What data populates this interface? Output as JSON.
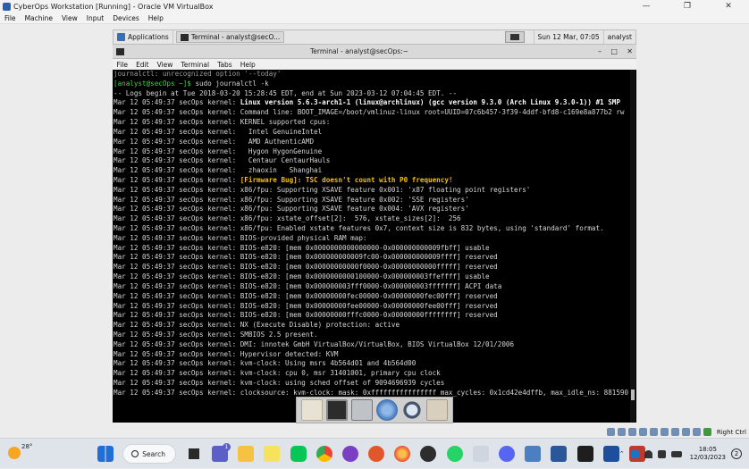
{
  "host_window": {
    "title": "CyberOps Workstation [Running] - Oracle VM VirtualBox",
    "controls": [
      "—",
      "❐",
      "✕"
    ],
    "menu": [
      "File",
      "Machine",
      "View",
      "Input",
      "Devices",
      "Help"
    ]
  },
  "guest_panel": {
    "applications_label": "Applications",
    "task_label": "Terminal - analyst@secO...",
    "clock": "Sun 12 Mar, 07:05",
    "user": "analyst"
  },
  "terminal": {
    "title": "Terminal - analyst@secOps:~",
    "controls": [
      "–",
      "□",
      "✕"
    ],
    "menu": [
      "File",
      "Edit",
      "View",
      "Terminal",
      "Tabs",
      "Help"
    ],
    "lines": [
      {
        "t": "journalctl: unrecognized option '--today'",
        "c": "dim"
      },
      {
        "p": "[analyst@secOps ~]$",
        "t": " sudo journalctl -k"
      },
      {
        "t": "-- Logs begin at Tue 2018-03-20 15:28:45 EDT, end at Sun 2023-03-12 07:04:45 EDT. --"
      },
      {
        "h": "Mar 12 05:49:37 secOps kernel: ",
        "t": "Linux version 5.6.3-arch1-1 (linux@archlinux) (gcc version 9.3.0 (Arch Linux 9.3.0-1)) #1 SMP",
        "c": "b"
      },
      {
        "h": "Mar 12 05:49:37 secOps kernel: ",
        "t": "Command line: BOOT_IMAGE=/boot/vmlinuz-linux root=UUID=07c6b457-3f39-4ddf-bfd8-c169e8a877b2 rw"
      },
      {
        "h": "Mar 12 05:49:37 secOps kernel: ",
        "t": "KERNEL supported cpus:"
      },
      {
        "h": "Mar 12 05:49:37 secOps kernel: ",
        "t": "  Intel GenuineIntel"
      },
      {
        "h": "Mar 12 05:49:37 secOps kernel: ",
        "t": "  AMD AuthenticAMD"
      },
      {
        "h": "Mar 12 05:49:37 secOps kernel: ",
        "t": "  Hygon HygonGenuine"
      },
      {
        "h": "Mar 12 05:49:37 secOps kernel: ",
        "t": "  Centaur CentaurHauls"
      },
      {
        "h": "Mar 12 05:49:37 secOps kernel: ",
        "t": "  zhaoxin   Shanghai"
      },
      {
        "h": "Mar 12 05:49:37 secOps kernel: ",
        "t": "[Firmware Bug]: TSC doesn't count with P0 frequency!",
        "c": "y"
      },
      {
        "h": "Mar 12 05:49:37 secOps kernel: ",
        "t": "x86/fpu: Supporting XSAVE feature 0x001: 'x87 floating point registers'"
      },
      {
        "h": "Mar 12 05:49:37 secOps kernel: ",
        "t": "x86/fpu: Supporting XSAVE feature 0x002: 'SSE registers'"
      },
      {
        "h": "Mar 12 05:49:37 secOps kernel: ",
        "t": "x86/fpu: Supporting XSAVE feature 0x004: 'AVX registers'"
      },
      {
        "h": "Mar 12 05:49:37 secOps kernel: ",
        "t": "x86/fpu: xstate_offset[2]:  576, xstate_sizes[2]:  256"
      },
      {
        "h": "Mar 12 05:49:37 secOps kernel: ",
        "t": "x86/fpu: Enabled xstate features 0x7, context size is 832 bytes, using 'standard' format."
      },
      {
        "h": "Mar 12 05:49:37 secOps kernel: ",
        "t": "BIOS-provided physical RAM map:"
      },
      {
        "h": "Mar 12 05:49:37 secOps kernel: ",
        "t": "BIOS-e820: [mem 0x0000000000000000-0x000000000009fbff] usable"
      },
      {
        "h": "Mar 12 05:49:37 secOps kernel: ",
        "t": "BIOS-e820: [mem 0x000000000009fc00-0x000000000009ffff] reserved"
      },
      {
        "h": "Mar 12 05:49:37 secOps kernel: ",
        "t": "BIOS-e820: [mem 0x00000000000f0000-0x00000000000fffff] reserved"
      },
      {
        "h": "Mar 12 05:49:37 secOps kernel: ",
        "t": "BIOS-e820: [mem 0x0000000000100000-0x000000003ffeffff] usable"
      },
      {
        "h": "Mar 12 05:49:37 secOps kernel: ",
        "t": "BIOS-e820: [mem 0x000000003fff0000-0x000000003fffffff] ACPI data"
      },
      {
        "h": "Mar 12 05:49:37 secOps kernel: ",
        "t": "BIOS-e820: [mem 0x00000000fec00000-0x00000000fec00fff] reserved"
      },
      {
        "h": "Mar 12 05:49:37 secOps kernel: ",
        "t": "BIOS-e820: [mem 0x00000000fee00000-0x00000000fee00fff] reserved"
      },
      {
        "h": "Mar 12 05:49:37 secOps kernel: ",
        "t": "BIOS-e820: [mem 0x00000000fffc0000-0x00000000ffffffff] reserved"
      },
      {
        "h": "Mar 12 05:49:37 secOps kernel: ",
        "t": "NX (Execute Disable) protection: active"
      },
      {
        "h": "Mar 12 05:49:37 secOps kernel: ",
        "t": "SMBIOS 2.5 present."
      },
      {
        "h": "Mar 12 05:49:37 secOps kernel: ",
        "t": "DMI: innotek GmbH VirtualBox/VirtualBox, BIOS VirtualBox 12/01/2006"
      },
      {
        "h": "Mar 12 05:49:37 secOps kernel: ",
        "t": "Hypervisor detected: KVM"
      },
      {
        "h": "Mar 12 05:49:37 secOps kernel: ",
        "t": "kvm-clock: Using msrs 4b564d01 and 4b564d00"
      },
      {
        "h": "Mar 12 05:49:37 secOps kernel: ",
        "t": "kvm-clock: cpu 0, msr 31401001, primary cpu clock"
      },
      {
        "h": "Mar 12 05:49:37 secOps kernel: ",
        "t": "kvm-clock: using sched offset of 9094696939 cycles"
      },
      {
        "h": "Mar 12 05:49:37 secOps kernel: ",
        "t": "clocksource: kvm-clock: mask: 0xffffffffffffffff max_cycles: 0x1cd42e4dffb, max_idle_ns: 881590"
      }
    ]
  },
  "guest_dock": {
    "icons": [
      "home-folder-icon",
      "terminal-icon",
      "file-manager-icon",
      "web-browser-icon",
      "app-finder-icon",
      "folder-icon"
    ]
  },
  "vbox_status": {
    "icons": [
      "hard-disk-icon",
      "optical-drive-icon",
      "audio-icon",
      "network-icon",
      "usb-icon",
      "shared-folder-icon",
      "display-icon",
      "recording-icon",
      "cpu-icon",
      "mouse-icon"
    ],
    "host_key": "Right Ctrl"
  },
  "taskbar": {
    "weather_temp": "28°",
    "search_label": "Search",
    "teams_badge": "1",
    "apps": [
      "windows-start-icon",
      "search",
      "task-view-icon",
      "teams-icon",
      "file-explorer-icon",
      "notes-icon",
      "line-icon",
      "chrome-icon",
      "app-purple-icon",
      "app-bird-icon",
      "firefox-icon",
      "app-flame-icon",
      "whatsapp-icon",
      "app-mail-icon",
      "discord-icon",
      "virtualbox-icon",
      "word-icon",
      "terminal-icon",
      "app-blue-icon",
      "snip-icon"
    ],
    "tray_icons": [
      "chevron-up-icon",
      "onedrive-icon",
      "wifi-icon",
      "speaker-icon",
      "battery-icon"
    ],
    "time": "18:05",
    "date": "12/03/2023",
    "notifications": "2"
  },
  "colors": {
    "terminal_bg": "#000000",
    "prompt": "#33dd33",
    "warning": "#f2c200",
    "taskbar_bg": "#dfe4ea"
  }
}
